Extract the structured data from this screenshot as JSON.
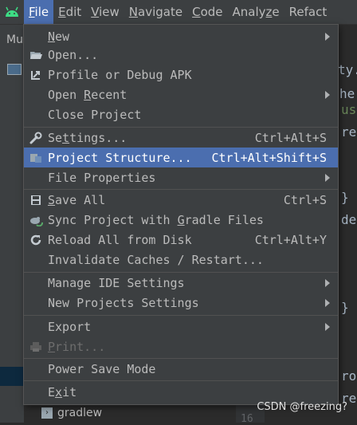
{
  "menubar": {
    "logo_icon": "android-icon",
    "items": [
      {
        "mnemonic": "F",
        "rest": "ile",
        "active": true
      },
      {
        "mnemonic": "E",
        "rest": "dit"
      },
      {
        "mnemonic": "V",
        "rest": "iew"
      },
      {
        "mnemonic": "N",
        "rest": "avigate"
      },
      {
        "mnemonic": "C",
        "rest": "ode"
      },
      {
        "before": "Analy",
        "mnemonic": "z",
        "rest": "e"
      },
      {
        "before": "Refact",
        "mnemonic": "",
        "rest": ""
      }
    ]
  },
  "background": {
    "tool_tab": "Mu",
    "tree_item": "gradlew",
    "line_number": "16",
    "editor_fragments": [
      "ty.",
      "he",
      "us",
      "re",
      "}",
      "de",
      "}",
      "ro",
      "re"
    ]
  },
  "file_menu": {
    "items": [
      {
        "icon": "",
        "before": "",
        "mnemonic": "N",
        "after": "ew",
        "shortcut": "",
        "submenu": true
      },
      {
        "icon": "folder-open-icon",
        "before": "Open...",
        "mnemonic": "",
        "after": "",
        "shortcut": "",
        "submenu": false
      },
      {
        "icon": "profile-apk-icon",
        "before": "Profile or Debug APK",
        "mnemonic": "",
        "after": "",
        "shortcut": "",
        "submenu": false
      },
      {
        "icon": "",
        "before": "Open ",
        "mnemonic": "R",
        "after": "ecent",
        "shortcut": "",
        "submenu": true
      },
      {
        "icon": "",
        "before": "Close Project",
        "mnemonic": "",
        "after": "",
        "shortcut": "",
        "submenu": false
      },
      {
        "icon": "wrench-icon",
        "before": "Se",
        "mnemonic": "t",
        "after": "tings...",
        "shortcut": "Ctrl+Alt+S",
        "submenu": false
      },
      {
        "icon": "project-structure-icon",
        "before": "Project Structure...",
        "mnemonic": "",
        "after": "",
        "shortcut": "Ctrl+Alt+Shift+S",
        "submenu": false,
        "highlighted": true
      },
      {
        "icon": "",
        "before": "File Properties",
        "mnemonic": "",
        "after": "",
        "shortcut": "",
        "submenu": true
      },
      {
        "icon": "save-icon",
        "before": "",
        "mnemonic": "S",
        "after": "ave All",
        "shortcut": "Ctrl+S",
        "submenu": false
      },
      {
        "icon": "gradle-sync-icon",
        "before": "Sync Project with ",
        "mnemonic": "G",
        "after": "radle Files",
        "shortcut": "",
        "submenu": false
      },
      {
        "icon": "reload-icon",
        "before": "Reload All from Disk",
        "mnemonic": "",
        "after": "",
        "shortcut": "Ctrl+Alt+Y",
        "submenu": false
      },
      {
        "icon": "",
        "before": "Invalidate Caches / Restart...",
        "mnemonic": "",
        "after": "",
        "shortcut": "",
        "submenu": false
      },
      {
        "icon": "",
        "before": "Manage IDE Settings",
        "mnemonic": "",
        "after": "",
        "shortcut": "",
        "submenu": true
      },
      {
        "icon": "",
        "before": "New Projects Settings",
        "mnemonic": "",
        "after": "",
        "shortcut": "",
        "submenu": true
      },
      {
        "icon": "",
        "before": "Export",
        "mnemonic": "",
        "after": "",
        "shortcut": "",
        "submenu": true
      },
      {
        "icon": "print-icon",
        "before": "",
        "mnemonic": "P",
        "after": "rint...",
        "shortcut": "",
        "submenu": false,
        "disabled": true
      },
      {
        "icon": "",
        "before": "Power Save Mode",
        "mnemonic": "",
        "after": "",
        "shortcut": "",
        "submenu": false
      },
      {
        "icon": "",
        "before": "E",
        "mnemonic": "x",
        "after": "it",
        "shortcut": "",
        "submenu": false
      }
    ]
  },
  "watermark": "CSDN @freezing?"
}
